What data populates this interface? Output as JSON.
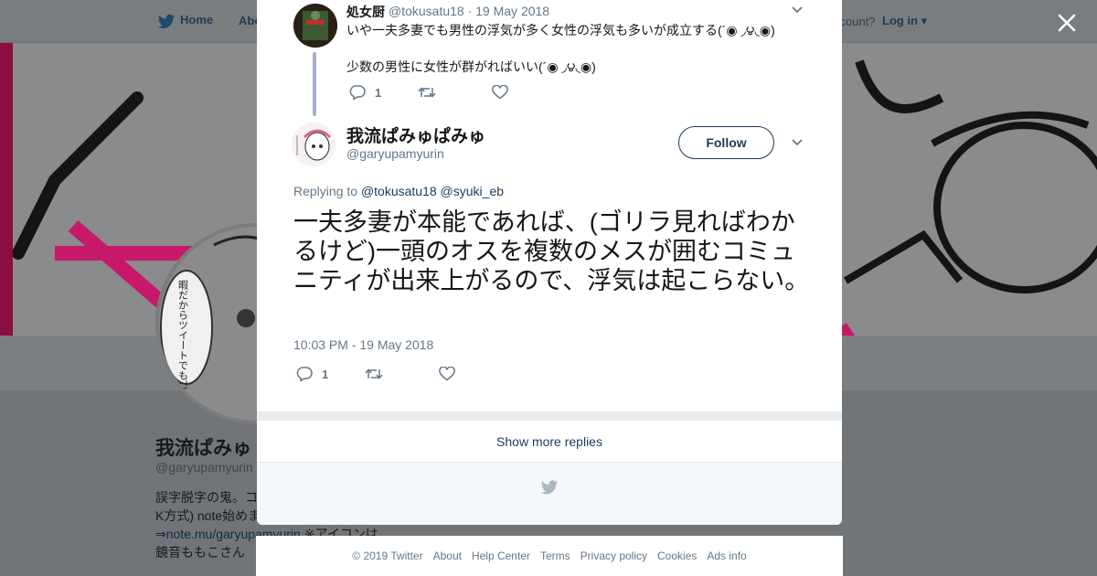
{
  "background": {
    "nav": {
      "home": "Home",
      "about": "Abo",
      "account_text": "ccount?",
      "login": "Log in"
    },
    "profile": {
      "name": "我流ぱみゅ",
      "handle": "@garyupamyurin",
      "bio_line1": "誤字脱字の鬼。コ",
      "bio_line2": "K方式) note始めま",
      "bio_line3_prefix": "⇒",
      "bio_link": "note.mu/garyupamyurin",
      "bio_line3_suffix": " ※アイコンは",
      "bio_line4": "鏡音ももこさん",
      "avatar_caption": "暇だからツイートでもTLに流すか不穏"
    }
  },
  "modal": {
    "tweet1": {
      "name": "処女厨",
      "handle": "@tokusatu18 · 19 May 2018",
      "line1": "いや一夫多妻でも男性の浮気が多く女性の浮気も多いが成立する(´◉ ◞౪◟◉)",
      "line2": "少数の男性に女性が群がればいい(´◉ ◞౪◟◉)",
      "reply_count": "1"
    },
    "tweet2": {
      "name": "我流ぱみゅぱみゅ",
      "handle": "@garyupamyurin",
      "follow": "Follow",
      "replying_prefix": "Replying to ",
      "mention1": "@tokusatu18",
      "mention2": "@syuki_eb",
      "text": "一夫多妻が本能であれば、(ゴリラ見ればわかるけど)一頭のオスを複数のメスが囲むコミュニティが出来上がるので、浮気は起こらない。",
      "timestamp": "10:03 PM - 19 May 2018",
      "reply_count": "1"
    },
    "show_more": "Show more replies"
  },
  "footer": {
    "copyright": "© 2019 Twitter",
    "about": "About",
    "help": "Help Center",
    "terms": "Terms",
    "privacy": "Privacy policy",
    "cookies": "Cookies",
    "ads": "Ads info"
  },
  "colors": {
    "accent": "#1b3a5c",
    "muted": "#657786",
    "overlay": "#7a7d80"
  }
}
